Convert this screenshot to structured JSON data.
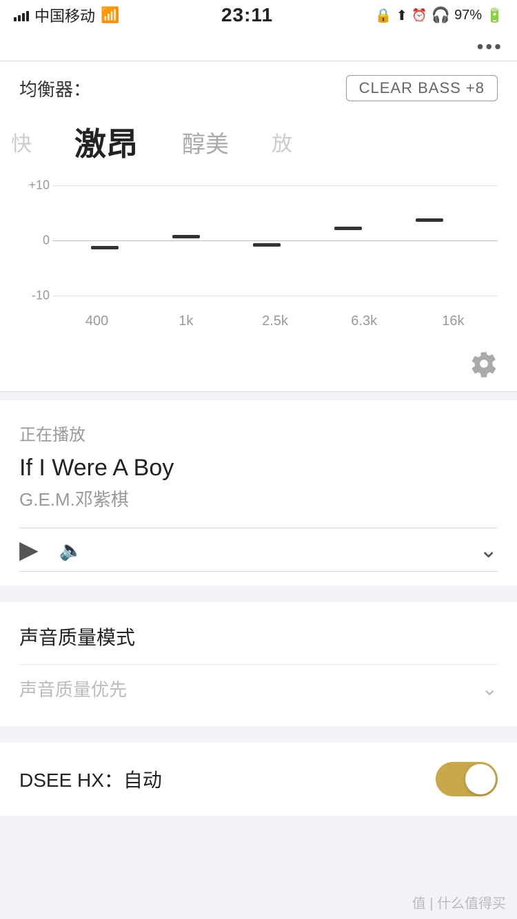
{
  "statusBar": {
    "carrier": "中国移动",
    "time": "23:11",
    "battery": "97%",
    "icons": [
      "wifi",
      "location",
      "alarm",
      "headphones",
      "signal"
    ]
  },
  "topDots": "•••",
  "equalizer": {
    "label": "均衡器：",
    "badge": "CLEAR BASS  +8",
    "presets": [
      {
        "id": "fast",
        "label": "快",
        "state": "partial-left"
      },
      {
        "id": "激昂",
        "label": "激昂",
        "state": "active"
      },
      {
        "id": "醇美",
        "label": "醇美",
        "state": "normal"
      },
      {
        "id": "放",
        "label": "放",
        "state": "partial-right"
      }
    ],
    "chart": {
      "yLabels": [
        "+10",
        "0",
        "-10"
      ],
      "freqLabels": [
        "400",
        "1k",
        "2.5k",
        "6.3k",
        "16k"
      ],
      "bars": [
        {
          "freq": "400",
          "value": -1
        },
        {
          "freq": "1k",
          "value": 1
        },
        {
          "freq": "2.5k",
          "value": -0.5
        },
        {
          "freq": "6.3k",
          "value": 2.5
        },
        {
          "freq": "16k",
          "value": 4
        }
      ]
    }
  },
  "nowPlaying": {
    "sectionTitle": "正在播放",
    "trackName": "If I Were A Boy",
    "artistName": "G.E.M.邓紫棋"
  },
  "soundQuality": {
    "sectionTitle": "声音质量模式",
    "currentOption": "声音质量优先"
  },
  "dsee": {
    "label": "DSEE HX：自动",
    "enabled": true
  },
  "watermark": "值 | 什么值得买"
}
